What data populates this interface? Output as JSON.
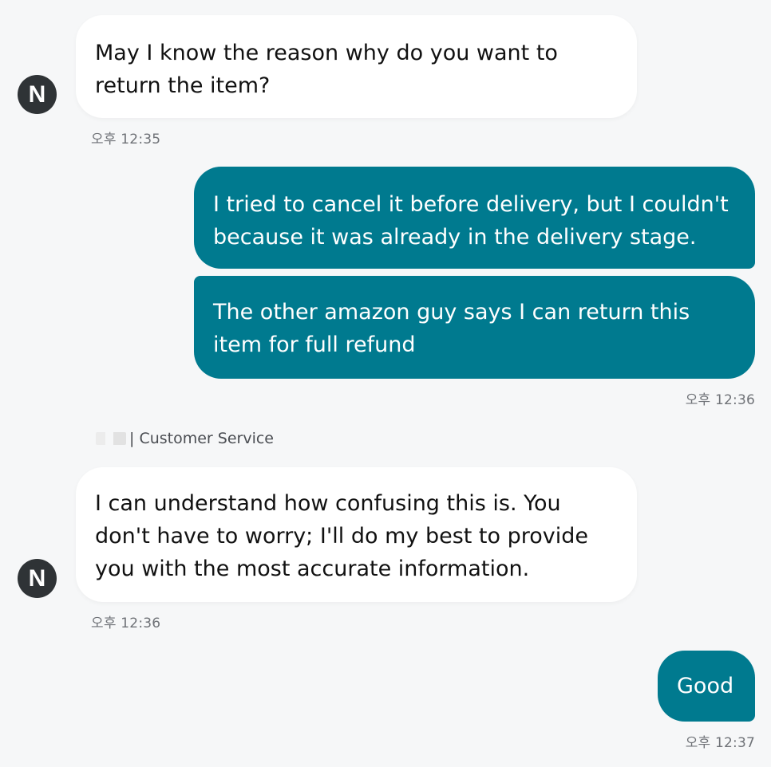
{
  "messages": [
    {
      "sender": "agent",
      "avatar_letter": "N",
      "text": "May I know the reason why do you want to return the item?",
      "time": "오후 12:35"
    },
    {
      "sender": "user",
      "text": "I tried to cancel it before delivery, but I couldn't because it was already in the delivery stage."
    },
    {
      "sender": "user",
      "text": "The other amazon guy says I can return this item for full refund",
      "time": "오후 12:36"
    },
    {
      "sender": "agent",
      "agent_label": "| Customer Service",
      "avatar_letter": "N",
      "text": "I can understand how confusing this is. You don't have to worry; I'll do my best to provide you with the most accurate information.",
      "time": "오후 12:36"
    },
    {
      "sender": "user",
      "text": "Good",
      "time": "오후 12:37"
    }
  ],
  "colors": {
    "user_bubble": "#007a8f",
    "agent_bubble": "#ffffff",
    "background": "#f6f7f8",
    "avatar": "#2f3336"
  }
}
